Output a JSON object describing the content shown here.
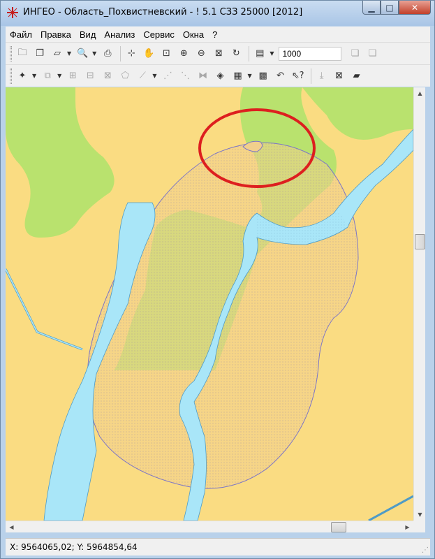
{
  "window": {
    "title": "ИНГЕО - Область_Похвистневский - ! 5.1 СЗЗ 25000 [2012]"
  },
  "menu": [
    "Файл",
    "Правка",
    "Вид",
    "Анализ",
    "Сервис",
    "Окна",
    "?"
  ],
  "toolbar1": {
    "icons": [
      "open-layer-icon",
      "layer-manager-icon",
      "eraser-icon",
      "select-icon",
      "print-icon",
      "measure-icon",
      "pan-icon",
      "zoom-window-icon",
      "zoom-in-icon",
      "zoom-out-icon",
      "zoom-extent-icon",
      "refresh-icon",
      "scale-icon"
    ],
    "scale_value": "1000"
  },
  "toolbar2": {
    "icons": [
      "new-object-icon",
      "copy-object-icon",
      "object-add-icon",
      "object-edit-icon",
      "object-delete-icon",
      "polygon-icon",
      "line-edit-icon",
      "node-add-icon",
      "node-delete-icon",
      "merge-icon",
      "style-icon",
      "table-icon",
      "semantics-icon",
      "undo-icon",
      "help-pointer-icon",
      "import-icon",
      "export-icon"
    ]
  },
  "map": {
    "colors": {
      "land": "#fadc82",
      "forest": "#b9e26e",
      "water": "#a9e6f8",
      "buffer_fill": "#f2cf8c",
      "buffer_stroke": "#7a74c8",
      "highlight_ring": "#dd1f1f"
    }
  },
  "status": {
    "coords": "X: 9564065,02; Y: 5964854,64"
  }
}
